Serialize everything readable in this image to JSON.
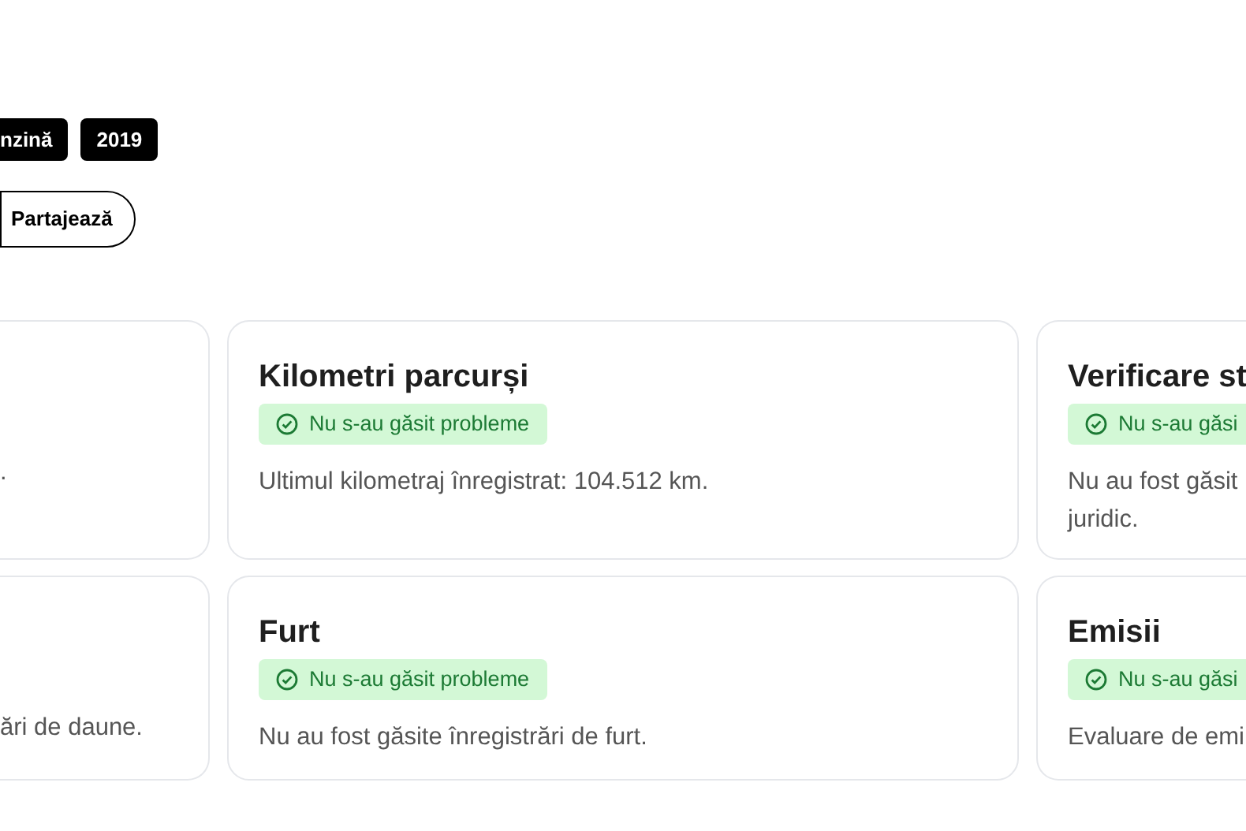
{
  "tags": [
    {
      "label": "nzină"
    },
    {
      "label": "2019"
    }
  ],
  "share_button": {
    "label": "Partajează"
  },
  "card_rows": [
    {
      "cards": [
        {
          "kind": "cutleft",
          "description_lines": [
            "."
          ]
        },
        {
          "kind": "full",
          "title": "Kilometri parcurși",
          "status": {
            "kind": "ok",
            "label": "Nu s-au găsit probleme"
          },
          "description_lines": [
            "Ultimul kilometraj înregistrat: 104.512 km."
          ]
        },
        {
          "kind": "cutright",
          "title": "Verificare st",
          "status": {
            "kind": "ok",
            "label": "Nu s-au găsi"
          },
          "description_lines": [
            "Nu au fost găsit",
            "juridic."
          ]
        }
      ]
    },
    {
      "cards": [
        {
          "kind": "cutleft",
          "description_lines": [
            "ări de daune."
          ]
        },
        {
          "kind": "full",
          "title": "Furt",
          "status": {
            "kind": "ok",
            "label": "Nu s-au găsit probleme"
          },
          "description_lines": [
            "Nu au fost găsite înregistrări de furt."
          ]
        },
        {
          "kind": "cutright",
          "title": "Emisii",
          "status": {
            "kind": "ok",
            "label": "Nu s-au găsi"
          },
          "description_lines": [
            "Evaluare de emi"
          ]
        }
      ]
    }
  ]
}
